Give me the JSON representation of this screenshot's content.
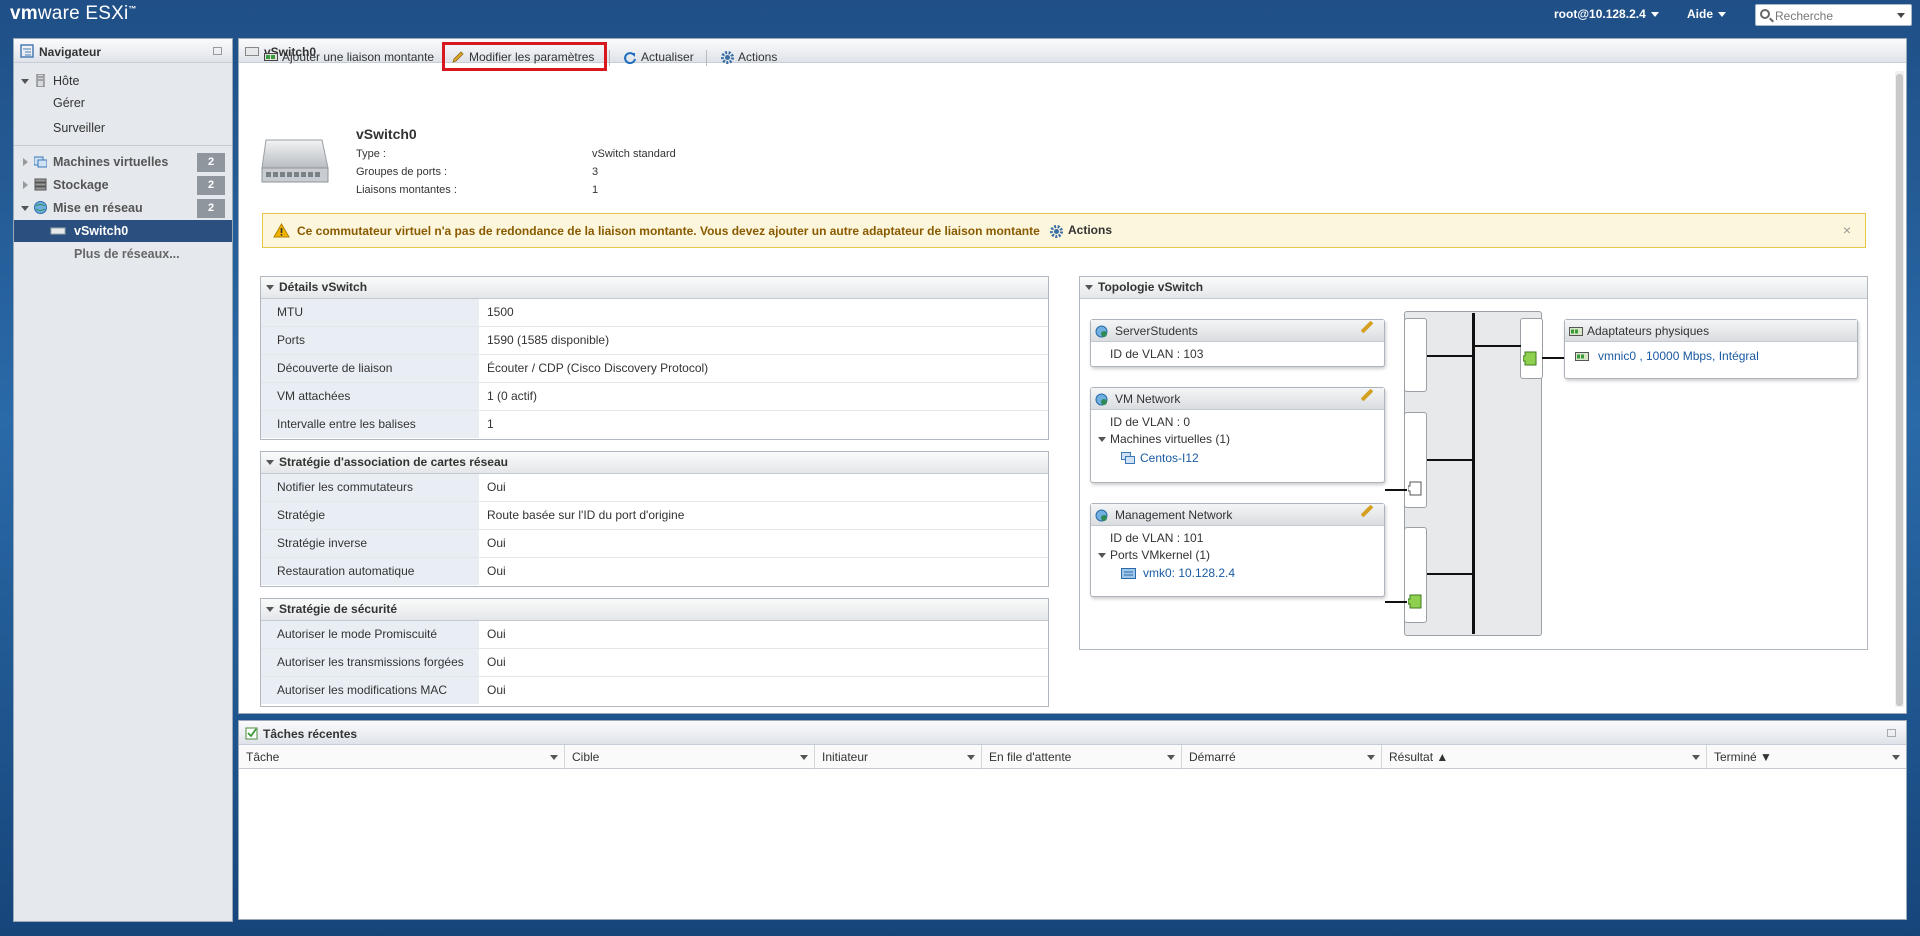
{
  "topbar": {
    "logo_vm": "vm",
    "logo_ware": "ware",
    "logo_product": " ESXi",
    "logo_tm": "™",
    "user": "root@10.128.2.4",
    "help": "Aide",
    "search_placeholder": "Recherche"
  },
  "navigator": {
    "title": "Navigateur",
    "host": "Hôte",
    "manage": "Gérer",
    "monitor": "Surveiller",
    "vms": {
      "label": "Machines virtuelles",
      "count": "2"
    },
    "storage": {
      "label": "Stockage",
      "count": "2"
    },
    "network": {
      "label": "Mise en réseau",
      "count": "2"
    },
    "vswitch": "vSwitch0",
    "more_networks": "Plus de réseaux..."
  },
  "main": {
    "title": "vSwitch0",
    "toolbar": {
      "add_uplink": "Ajouter une liaison montante",
      "edit_settings": "Modifier les paramètres",
      "refresh": "Actualiser",
      "actions": "Actions"
    },
    "summary": {
      "name": "vSwitch0",
      "type_label": "Type :",
      "type_value": "vSwitch standard",
      "portgroups_label": "Groupes de ports :",
      "portgroups_value": "3",
      "uplinks_label": "Liaisons montantes :",
      "uplinks_value": "1"
    },
    "warning": {
      "text": "Ce commutateur virtuel n'a pas de redondance de la liaison montante. Vous devez ajouter un autre adaptateur de liaison montante",
      "action": "Actions",
      "close": "×"
    },
    "details": {
      "title": "Détails vSwitch",
      "rows": [
        {
          "k": "MTU",
          "v": "1500"
        },
        {
          "k": "Ports",
          "v": "1590 (1585 disponible)"
        },
        {
          "k": "Découverte de liaison",
          "v": "Écouter / CDP (Cisco Discovery Protocol)"
        },
        {
          "k": "VM attachées",
          "v": "1 (0 actif)"
        },
        {
          "k": "Intervalle entre les balises",
          "v": "1"
        }
      ]
    },
    "teaming": {
      "title": "Stratégie d'association de cartes réseau",
      "rows": [
        {
          "k": "Notifier les commutateurs",
          "v": "Oui"
        },
        {
          "k": "Stratégie",
          "v": "Route basée sur l'ID du port d'origine"
        },
        {
          "k": "Stratégie inverse",
          "v": "Oui"
        },
        {
          "k": "Restauration automatique",
          "v": "Oui"
        }
      ]
    },
    "security": {
      "title": "Stratégie de sécurité",
      "rows": [
        {
          "k": "Autoriser le mode Promiscuité",
          "v": "Oui"
        },
        {
          "k": "Autoriser les transmissions forgées",
          "v": "Oui"
        },
        {
          "k": "Autoriser les modifications MAC",
          "v": "Oui"
        }
      ]
    },
    "topology": {
      "title": "Topologie vSwitch",
      "pg1": {
        "name": "ServerStudents",
        "vlan": "ID de VLAN : 103"
      },
      "pg2": {
        "name": "VM Network",
        "vlan": "ID de VLAN : 0",
        "sub": "Machines virtuelles (1)",
        "item": "Centos-I12"
      },
      "pg3": {
        "name": "Management Network",
        "vlan": "ID de VLAN : 101",
        "sub": "Ports VMkernel (1)",
        "item": "vmk0: 10.128.2.4"
      },
      "physical": {
        "title": "Adaptateurs physiques",
        "item": "vmnic0 , 10000 Mbps, Intégral"
      }
    }
  },
  "tasks": {
    "title": "Tâches récentes",
    "columns": [
      "Tâche",
      "Cible",
      "Initiateur",
      "En file d'attente",
      "Démarré",
      "Résultat ▲",
      "Terminé ▼"
    ]
  }
}
